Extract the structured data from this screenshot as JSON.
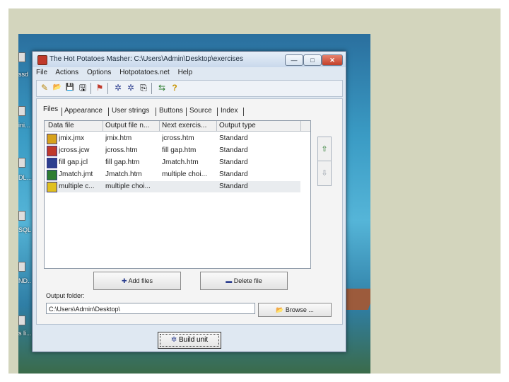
{
  "window": {
    "title": "The Hot Potatoes Masher: C:\\Users\\Admin\\Desktop\\exercises",
    "controls": {
      "minimize": "—",
      "maximize": "□",
      "close": "✕"
    }
  },
  "desktop": {
    "labels": [
      "ssd",
      "ini...",
      "DL...",
      "SQL",
      "ND..",
      "s li..."
    ]
  },
  "menu": [
    "File",
    "Actions",
    "Options",
    "Hotpotatoes.net",
    "Help"
  ],
  "toolbar": {
    "icons": [
      "new-icon",
      "open-icon",
      "save-icon",
      "save-as-icon",
      "flag-icon",
      "gear-icon",
      "gear-2-icon",
      "copy-icon",
      "web-icon",
      "help-icon"
    ],
    "glyphs": {
      "new": "✎",
      "open": "📂",
      "save": "💾",
      "save_as": "🖫",
      "flag": "⚑",
      "gear": "✲",
      "gear2": "✲",
      "copy": "⎘",
      "web": "⇆",
      "help": "?"
    }
  },
  "tabs": [
    "Files",
    "Appearance",
    "User strings",
    "Buttons",
    "Source",
    "Index"
  ],
  "file_list": {
    "columns": [
      "Data file",
      "Output file n...",
      "Next exercis...",
      "Output type"
    ],
    "rows": [
      {
        "data_file": "jmix.jmx",
        "output_file": "jmix.htm",
        "next_exercise": "jcross.htm",
        "output_type": "Standard"
      },
      {
        "data_file": "jcross.jcw",
        "output_file": "jcross.htm",
        "next_exercise": "fill gap.htm",
        "output_type": "Standard"
      },
      {
        "data_file": "fill gap.jcl",
        "output_file": "fill gap.htm",
        "next_exercise": "Jmatch.htm",
        "output_type": "Standard"
      },
      {
        "data_file": "Jmatch.jmt",
        "output_file": "Jmatch.htm",
        "next_exercise": "multiple choi...",
        "output_type": "Standard"
      },
      {
        "data_file": "multiple c...",
        "output_file": "multiple choi...",
        "next_exercise": "",
        "output_type": "Standard"
      }
    ]
  },
  "side_buttons": {
    "up": "⇧",
    "down": "⇩"
  },
  "buttons": {
    "add_files": "Add files",
    "add_icon": "✚",
    "delete_file": "Delete file",
    "delete_icon": "▬",
    "browse": "Browse ...",
    "browse_icon": "📂",
    "build_unit": "Build unit",
    "build_icon": "✲"
  },
  "output_folder": {
    "label": "Output folder:",
    "value": "C:\\Users\\Admin\\Desktop\\"
  },
  "colors": {
    "accent": "#c2402a",
    "window_bg": "#dfe8f2",
    "slide_band": "#d3d5bd"
  }
}
